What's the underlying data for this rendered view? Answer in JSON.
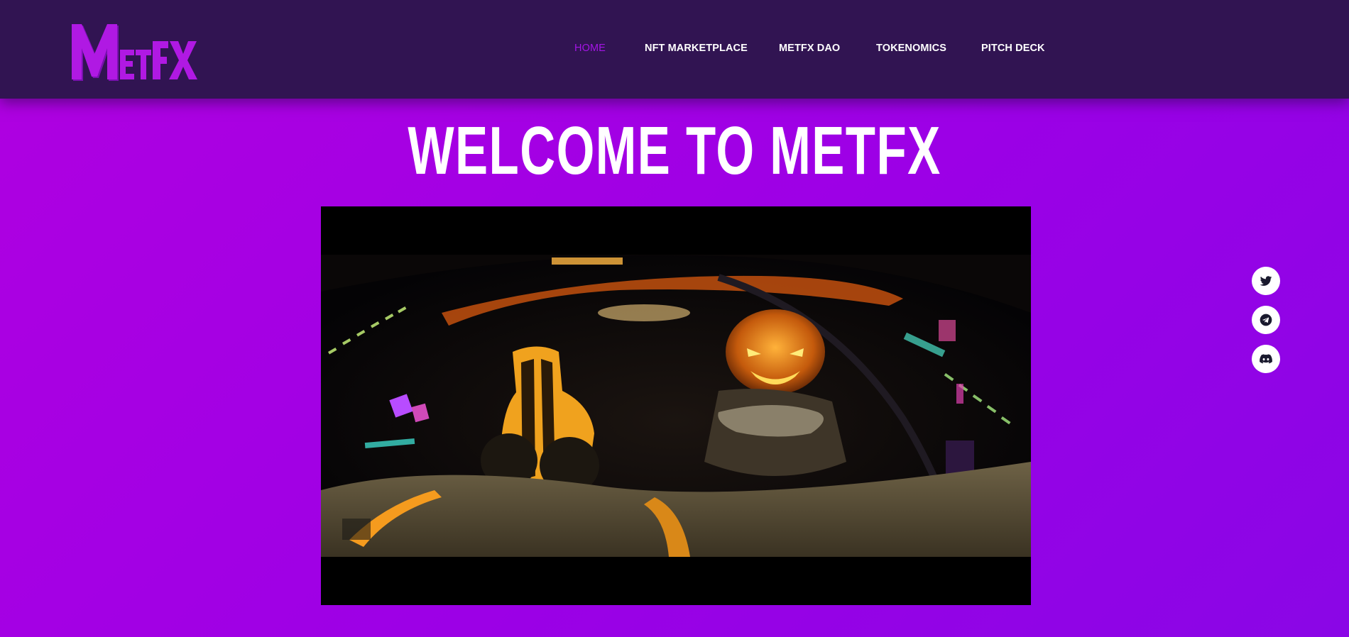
{
  "brand": {
    "logo_text": "MetFX",
    "logo_color": "#b019e3",
    "logo_shadow": "#7a10b0"
  },
  "nav": {
    "items": [
      {
        "label": "HOME",
        "active": true
      },
      {
        "label": "NFT MARKETPLACE",
        "active": false
      },
      {
        "label": "METFX DAO",
        "active": false
      },
      {
        "label": "TOKENOMICS",
        "active": false
      },
      {
        "label": "PITCH DECK",
        "active": false
      }
    ]
  },
  "hero": {
    "title": "WELCOME TO METFX"
  },
  "video": {
    "description_icon": "video-player"
  },
  "social": {
    "links": [
      {
        "icon": "twitter-icon"
      },
      {
        "icon": "telegram-icon"
      },
      {
        "icon": "discord-icon"
      }
    ]
  },
  "colors": {
    "header_bg": "#311452",
    "page_gradient_start": "#b000e0",
    "page_gradient_end": "#8a06e6",
    "nav_active": "#a414e6",
    "text": "#ffffff"
  }
}
